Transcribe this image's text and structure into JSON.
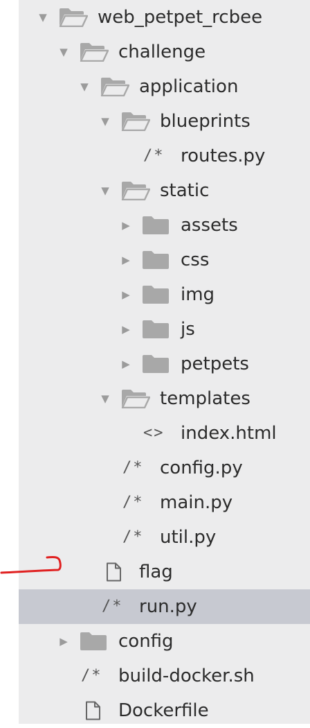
{
  "tree": {
    "items": [
      {
        "label": "web_petpet_rcbee",
        "icon": "folder-open-icon",
        "toggle": "expanded"
      },
      {
        "label": "challenge",
        "icon": "folder-open-icon",
        "toggle": "expanded"
      },
      {
        "label": "application",
        "icon": "folder-open-icon",
        "toggle": "expanded"
      },
      {
        "label": "blueprints",
        "icon": "folder-open-icon",
        "toggle": "expanded"
      },
      {
        "label": "routes.py",
        "icon": "code-comment-file-icon",
        "glyph": "/*"
      },
      {
        "label": "static",
        "icon": "folder-open-icon",
        "toggle": "expanded"
      },
      {
        "label": "assets",
        "icon": "folder-icon",
        "toggle": "collapsed"
      },
      {
        "label": "css",
        "icon": "folder-icon",
        "toggle": "collapsed"
      },
      {
        "label": "img",
        "icon": "folder-icon",
        "toggle": "collapsed"
      },
      {
        "label": "js",
        "icon": "folder-icon",
        "toggle": "collapsed"
      },
      {
        "label": "petpets",
        "icon": "folder-icon",
        "toggle": "collapsed"
      },
      {
        "label": "templates",
        "icon": "folder-open-icon",
        "toggle": "expanded"
      },
      {
        "label": "index.html",
        "icon": "html-file-icon",
        "glyph": "<>"
      },
      {
        "label": "config.py",
        "icon": "code-comment-file-icon",
        "glyph": "/*"
      },
      {
        "label": "main.py",
        "icon": "code-comment-file-icon",
        "glyph": "/*"
      },
      {
        "label": "util.py",
        "icon": "code-comment-file-icon",
        "glyph": "/*"
      },
      {
        "label": "flag",
        "icon": "file-icon"
      },
      {
        "label": "run.py",
        "icon": "code-comment-file-icon",
        "glyph": "/*",
        "selected": true
      },
      {
        "label": "config",
        "icon": "folder-icon",
        "toggle": "collapsed"
      },
      {
        "label": "build-docker.sh",
        "icon": "code-comment-file-icon",
        "glyph": "/*"
      },
      {
        "label": "Dockerfile",
        "icon": "file-icon"
      }
    ]
  },
  "colors": {
    "sidebar_bg": "#ececed",
    "selected_bg": "#c7c9d1",
    "folder_icon": "#a8a8a8",
    "annotation": "#e02020"
  }
}
